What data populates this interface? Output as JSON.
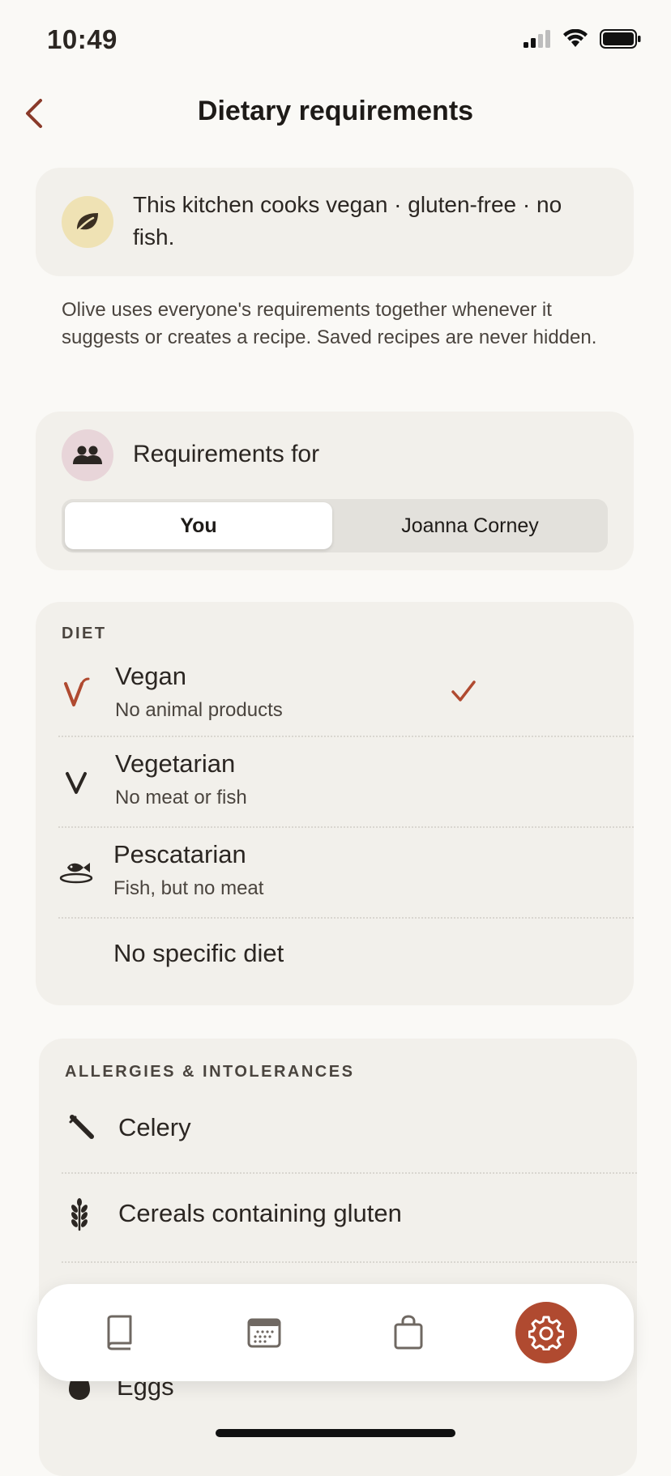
{
  "status_bar": {
    "time": "10:49"
  },
  "header": {
    "title": "Dietary requirements"
  },
  "kitchen": {
    "text": "This kitchen cooks vegan · gluten-free · no fish."
  },
  "info": {
    "text": "Olive uses everyone's requirements together whenever it suggests or creates a recipe. Saved recipes are never hidden."
  },
  "requirements_for": {
    "label": "Requirements for",
    "options": [
      "You",
      "Joanna Corney"
    ],
    "selected": "You"
  },
  "diet": {
    "heading": "DIET",
    "items": [
      {
        "title": "Vegan",
        "subtitle": "No animal products",
        "icon": "vegan-icon",
        "selected": true
      },
      {
        "title": "Vegetarian",
        "subtitle": "No meat or fish",
        "icon": "vegetarian-icon",
        "selected": false
      },
      {
        "title": "Pescatarian",
        "subtitle": "Fish, but no meat",
        "icon": "fish-icon",
        "selected": false
      },
      {
        "title": "No specific diet",
        "subtitle": "",
        "icon": "",
        "selected": false
      }
    ]
  },
  "allergies": {
    "heading": "ALLERGIES & INTOLERANCES",
    "items": [
      {
        "title": "Celery",
        "icon": "celery-icon"
      },
      {
        "title": "Cereals containing gluten",
        "icon": "wheat-icon"
      },
      {
        "title": "Eggs",
        "icon": "egg-icon"
      }
    ]
  },
  "tab_bar": {
    "tabs": [
      "recipes-book-icon",
      "calendar-icon",
      "shopping-bag-icon",
      "settings-gear-icon"
    ],
    "active": "settings-gear-icon"
  },
  "colors": {
    "accent": "#b04a30",
    "card": "#f2f0eb",
    "background": "#faf9f6"
  }
}
